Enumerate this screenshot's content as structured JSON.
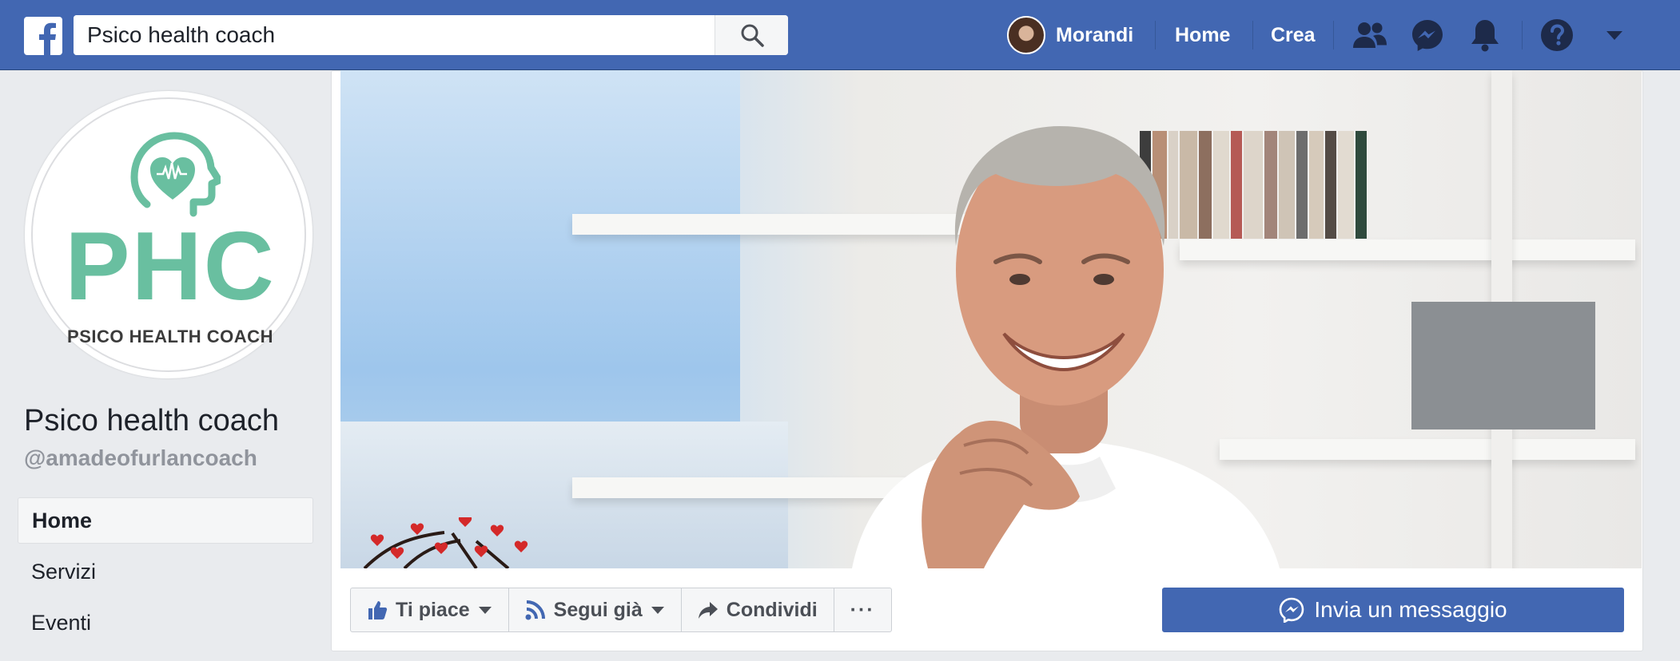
{
  "topbar": {
    "search_value": "Psico health coach",
    "user_name": "Morandi",
    "nav_home": "Home",
    "nav_create": "Crea"
  },
  "profile": {
    "logo_text": "PHC",
    "logo_subtext": "PSICO HEALTH COACH",
    "page_name": "Psico health coach",
    "page_handle": "@amadeofurlancoach"
  },
  "sidebar": {
    "items": [
      {
        "label": "Home",
        "active": true
      },
      {
        "label": "Servizi",
        "active": false
      },
      {
        "label": "Eventi",
        "active": false
      }
    ]
  },
  "actions": {
    "like": "Ti piace",
    "follow": "Segui già",
    "share": "Condividi",
    "more": "···",
    "message": "Invia un messaggio"
  },
  "colors": {
    "brand": "#4267b2",
    "logo_green": "#69bfa0"
  }
}
